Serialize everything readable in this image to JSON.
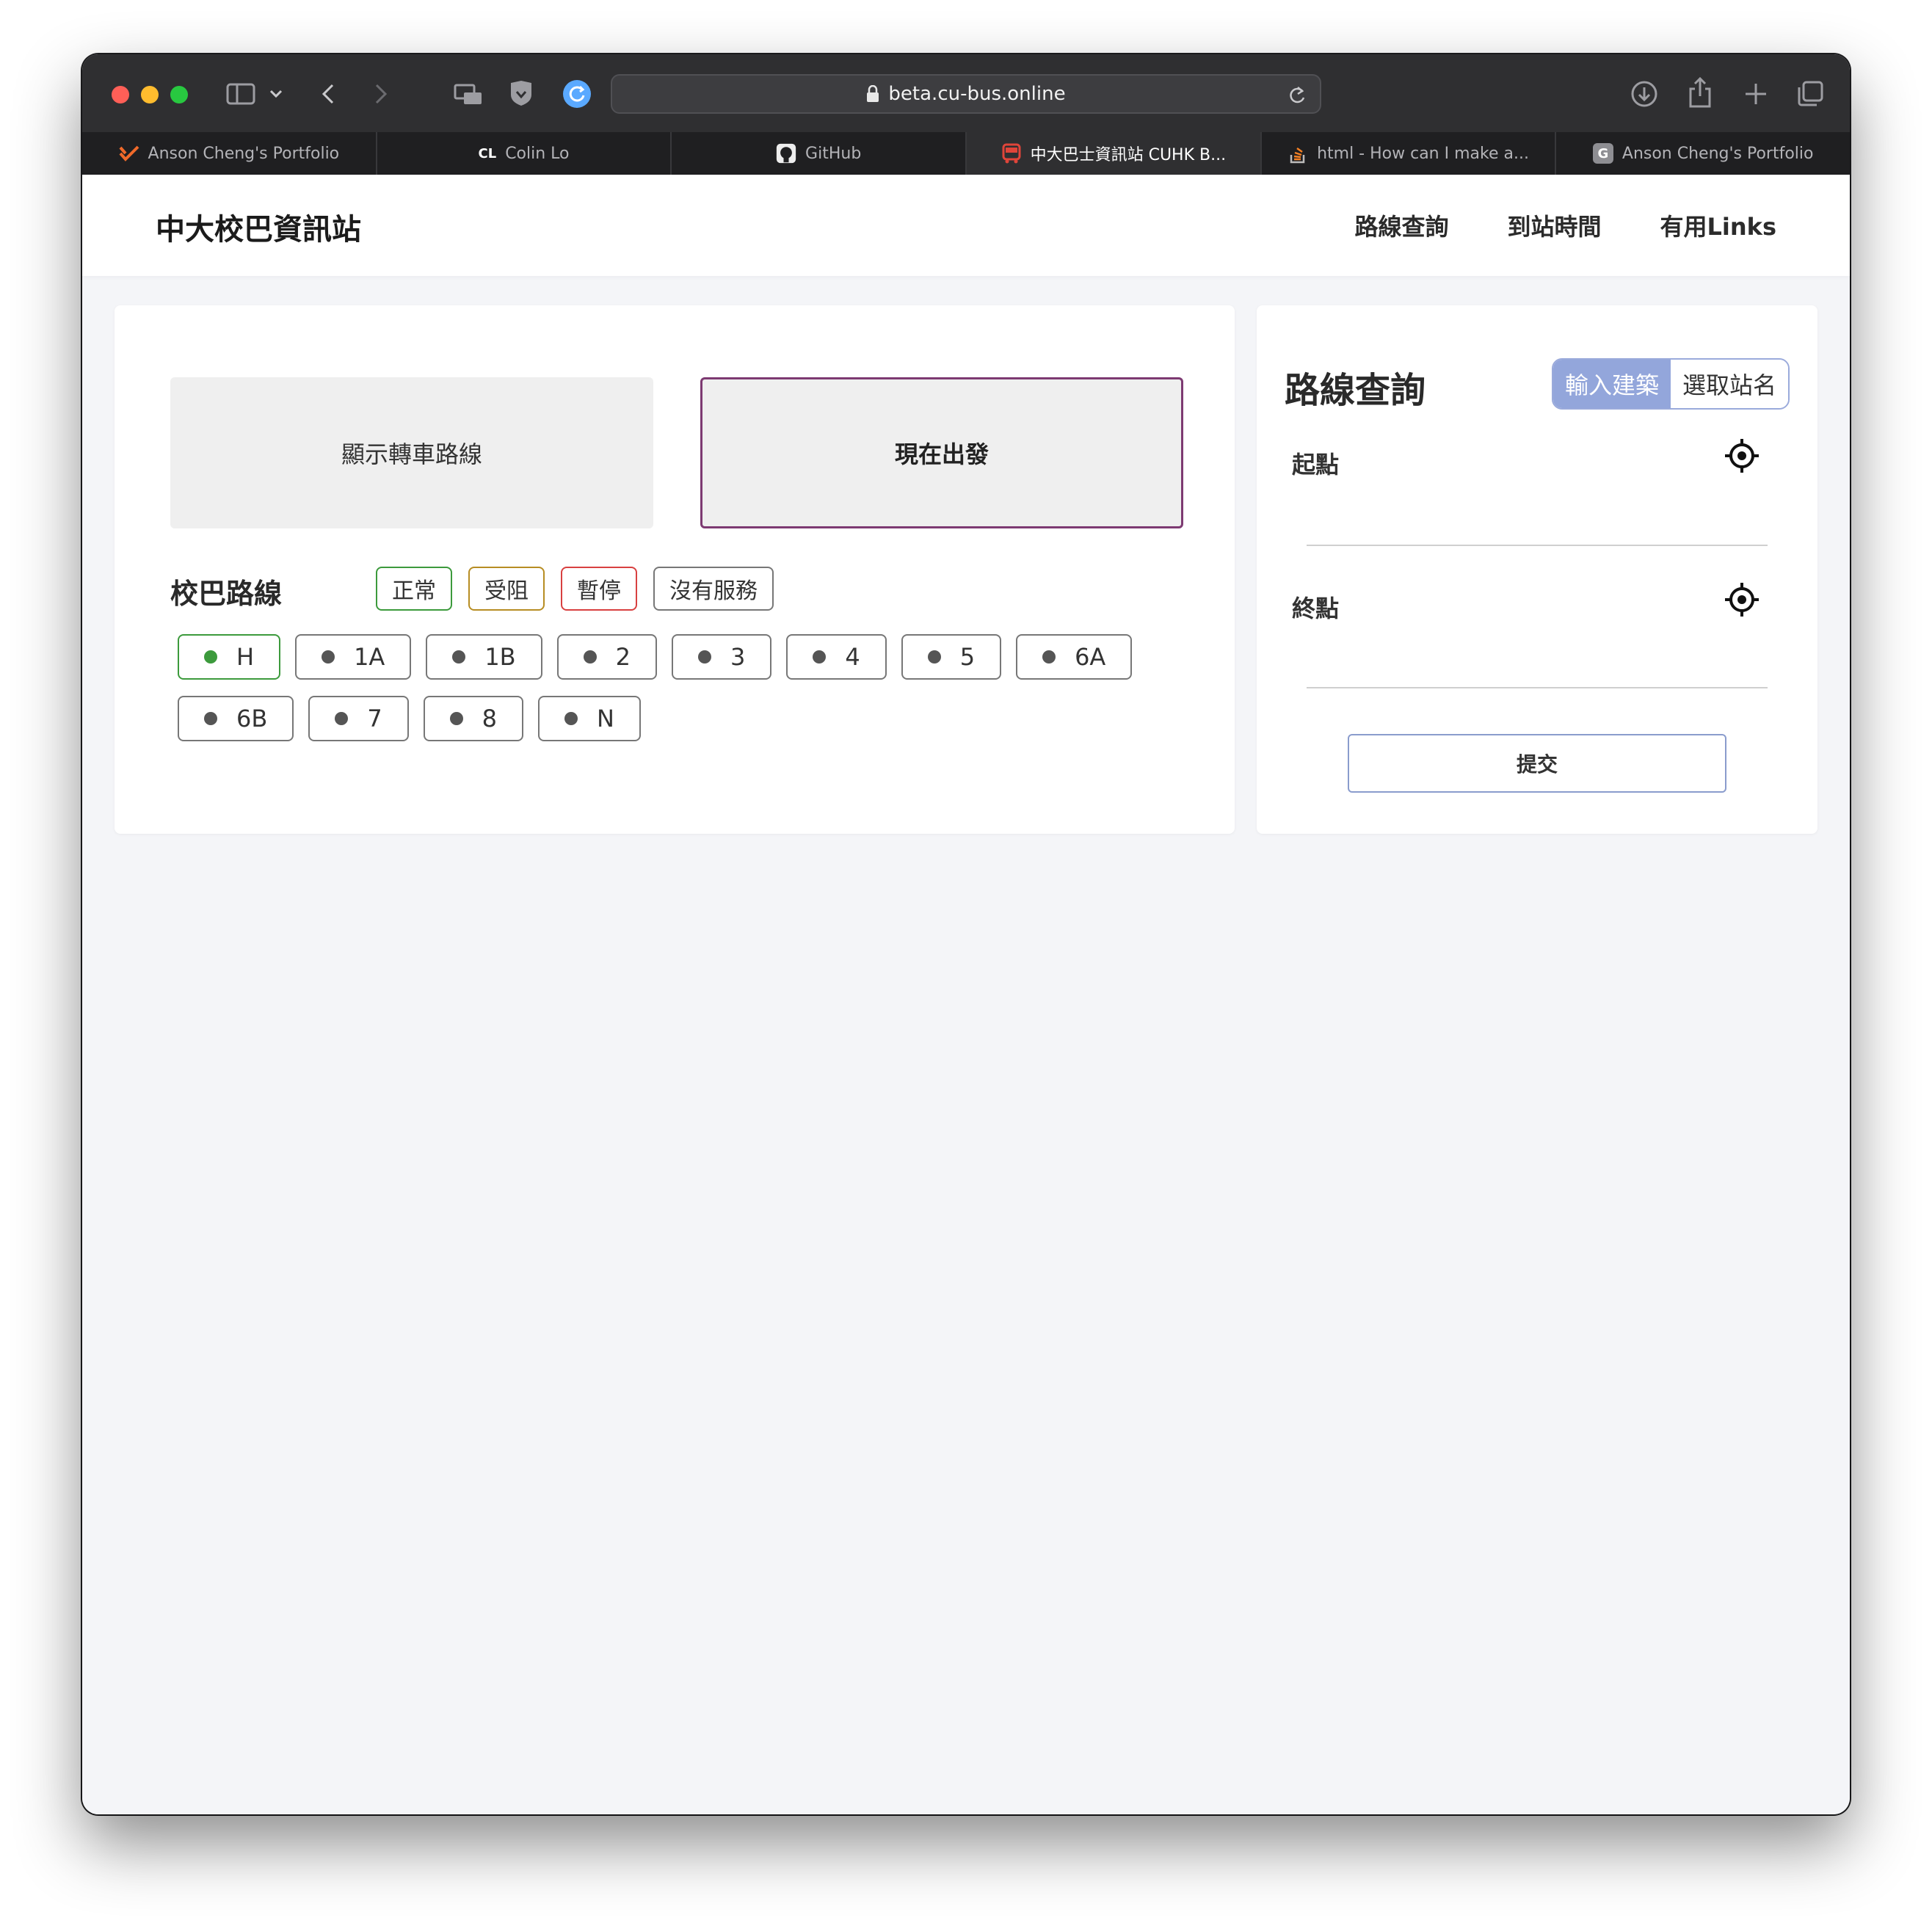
{
  "browser": {
    "url": "beta.cu-bus.online",
    "tabs": [
      {
        "title": "Anson Cheng's Portfolio",
        "favicon": "check-logo-icon"
      },
      {
        "title": "Colin Lo",
        "favicon": "CL"
      },
      {
        "title": "GitHub",
        "favicon": "github-icon"
      },
      {
        "title": "中大巴士資訊站 CUHK B...",
        "favicon": "bus-icon",
        "active": true
      },
      {
        "title": "html - How can I make a...",
        "favicon": "stackoverflow-icon"
      },
      {
        "title": "Anson Cheng's Portfolio",
        "favicon": "G"
      }
    ]
  },
  "nav": {
    "brand": "中大校巴資訊站",
    "links": [
      "路線查詢",
      "到站時間",
      "有用Links"
    ]
  },
  "main": {
    "btn_transfer": "顯示轉車路線",
    "btn_depart_now": "現在出發",
    "section_title": "校巴路線",
    "legend": [
      "正常",
      "受阻",
      "暫停",
      "沒有服務"
    ],
    "routes": [
      "H",
      "1A",
      "1B",
      "2",
      "3",
      "4",
      "5",
      "6A",
      "6B",
      "7",
      "8",
      "N"
    ],
    "route_status": {
      "H": "normal"
    }
  },
  "route_search": {
    "title": "路線查詢",
    "mode_options": [
      "輸入建築",
      "選取站名"
    ],
    "mode_selected": "輸入建築",
    "origin_label": "起點",
    "destination_label": "終點",
    "submit_label": "提交"
  },
  "colors": {
    "normal": "#3c9a3c",
    "blocked": "#b78d23",
    "suspended": "#d84040",
    "no_service": "#777777",
    "accent_primary": "#7d3a72",
    "accent_toggle": "#93a6db"
  }
}
